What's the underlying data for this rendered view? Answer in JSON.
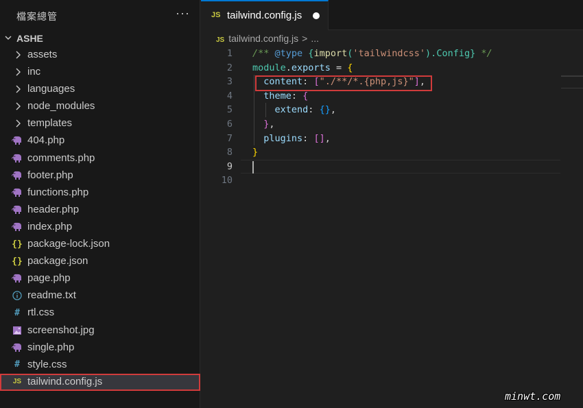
{
  "explorer": {
    "title": "檔案總管",
    "more": "···",
    "root": "ASHE",
    "items": [
      {
        "name": "assets",
        "kind": "folder"
      },
      {
        "name": "inc",
        "kind": "folder"
      },
      {
        "name": "languages",
        "kind": "folder"
      },
      {
        "name": "node_modules",
        "kind": "folder"
      },
      {
        "name": "templates",
        "kind": "folder"
      },
      {
        "name": "404.php",
        "kind": "php"
      },
      {
        "name": "comments.php",
        "kind": "php"
      },
      {
        "name": "footer.php",
        "kind": "php"
      },
      {
        "name": "functions.php",
        "kind": "php"
      },
      {
        "name": "header.php",
        "kind": "php"
      },
      {
        "name": "index.php",
        "kind": "php"
      },
      {
        "name": "package-lock.json",
        "kind": "json"
      },
      {
        "name": "package.json",
        "kind": "json"
      },
      {
        "name": "page.php",
        "kind": "php"
      },
      {
        "name": "readme.txt",
        "kind": "info"
      },
      {
        "name": "rtl.css",
        "kind": "css"
      },
      {
        "name": "screenshot.jpg",
        "kind": "image"
      },
      {
        "name": "single.php",
        "kind": "php"
      },
      {
        "name": "style.css",
        "kind": "css"
      },
      {
        "name": "tailwind.config.js",
        "kind": "js",
        "selected": true
      }
    ]
  },
  "icons": {
    "folder": "chevron-right-icon",
    "php": "elephant-icon",
    "json": "braces-icon",
    "info": "info-icon",
    "css": "hash-icon",
    "image": "image-icon",
    "js": "js-icon"
  },
  "tab": {
    "badge": "JS",
    "label": "tailwind.config.js",
    "dirty": "●"
  },
  "breadcrumb": {
    "badge": "JS",
    "file": "tailwind.config.js",
    "sep": ">",
    "rest": "..."
  },
  "code": {
    "line_numbers": [
      "1",
      "2",
      "3",
      "4",
      "5",
      "6",
      "7",
      "8",
      "9",
      "10"
    ],
    "active_line": "9",
    "l1": {
      "open": "/** ",
      "tag": "@type",
      "sp": " ",
      "b_open": "{",
      "fn": "import",
      "p_open": "(",
      "str": "'tailwindcss'",
      "p_close": ")",
      "dot": ".",
      "type": "Config",
      "b_close": "}",
      "close": " */"
    },
    "l2": {
      "obj": "module",
      "dot": ".",
      "prop": "exports",
      "eq": " = ",
      "brace": "{"
    },
    "l3": {
      "indent": "  ",
      "key": "content",
      "colon": ": ",
      "br_open": "[",
      "str": "\"./**/*.{php,js}\"",
      "br_close": "]",
      "comma": ","
    },
    "l4": {
      "indent": "  ",
      "key": "theme",
      "colon": ": ",
      "brace": "{"
    },
    "l5": {
      "indent": "    ",
      "key": "extend",
      "colon": ": ",
      "brace": "{}",
      "comma": ","
    },
    "l6": {
      "indent": "  ",
      "brace": "}",
      "comma": ","
    },
    "l7": {
      "indent": "  ",
      "key": "plugins",
      "colon": ": ",
      "br": "[]",
      "comma": ","
    },
    "l8": {
      "brace": "}"
    }
  },
  "colors": {
    "accent": "#0078d4",
    "highlight": "#d13b3b",
    "js_yellow": "#cbcb41",
    "php_purple": "#a074c4"
  },
  "watermark": "minwt.com"
}
